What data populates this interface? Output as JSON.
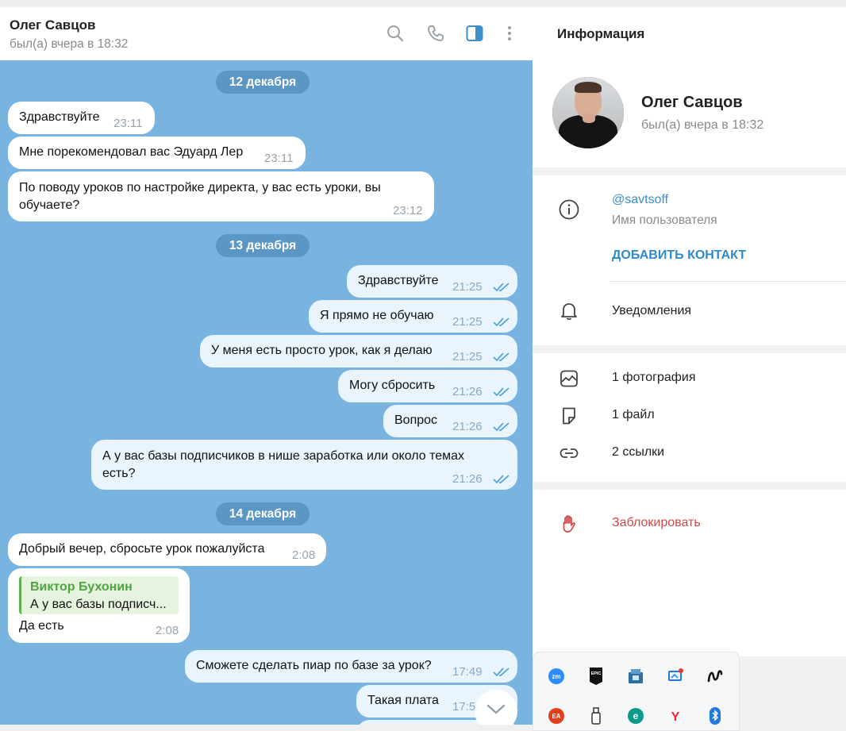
{
  "header": {
    "contact_name": "Олег Савцов",
    "status": "был(а) вчера в 18:32"
  },
  "header_icons": [
    "search-icon",
    "phone-icon",
    "sidebar-toggle-icon",
    "more-vertical-icon"
  ],
  "dates": [
    "12 декабря",
    "13 декабря",
    "14 декабря"
  ],
  "messages": [
    {
      "dir": "in",
      "text": "Здравствуйте",
      "time": "23:11"
    },
    {
      "dir": "in",
      "text": "Мне порекомендовал вас Эдуард Лер",
      "time": "23:11"
    },
    {
      "dir": "in",
      "line1": "По поводу уроков по настройке директа, у вас есть уроки, вы",
      "line2": "обучаете?",
      "time": "23:12"
    },
    {
      "dir": "out",
      "text": "Здравствуйте",
      "time": "21:25"
    },
    {
      "dir": "out",
      "text": "Я прямо не обучаю",
      "time": "21:25"
    },
    {
      "dir": "out",
      "text": "У меня есть просто урок, как я делаю",
      "time": "21:25"
    },
    {
      "dir": "out",
      "text": "Могу сбросить",
      "time": "21:26"
    },
    {
      "dir": "out",
      "text": "Вопрос",
      "time": "21:26"
    },
    {
      "dir": "out",
      "line1": "А у вас базы подписчиков в нише заработка или около темах",
      "line2": "есть?",
      "time": "21:26"
    },
    {
      "dir": "in",
      "text": "Добрый вечер, сбросьте урок пожалуйста",
      "time": "2:08"
    },
    {
      "dir": "in",
      "reply_name": "Виктор Бухонин",
      "reply_text": "А у вас базы подписч...",
      "text": "Да есть",
      "time": "2:08"
    },
    {
      "dir": "out",
      "text": "Сможете сделать пиар по базе за урок?",
      "time": "17:49"
    },
    {
      "dir": "out",
      "text": "Такая плата",
      "time": "17:5"
    }
  ],
  "info": {
    "title": "Информация",
    "name": "Олег Савцов",
    "status": "был(а) вчера в 18:32",
    "username": "@savtsoff",
    "username_label": "Имя пользователя",
    "add_contact": "ДОБАВИТЬ КОНТАКТ",
    "notifications": "Уведомления",
    "photos": "1 фотография",
    "files": "1 файл",
    "links": "2 ссылки",
    "block": "Заблокировать"
  },
  "tray": {
    "icons": [
      "zoom-icon",
      "epic-games-icon",
      "network-drive-icon",
      "remote-desktop-icon",
      "notion-icon",
      "ea-icon",
      "usb-drive-icon",
      "eset-icon",
      "yandex-browser-icon",
      "bluetooth-icon"
    ],
    "labels": {
      "zoom": "zm",
      "epic": "EPIC",
      "ea": "EA",
      "eset": "e",
      "yandex": "Y"
    }
  },
  "colors": {
    "chat_bg": "#79b4e0",
    "date_pill": "#5a97c5",
    "out_bubble": "#e9f4fd",
    "accent": "#3b8fcb",
    "danger": "#d14848",
    "reply_name": "#4ea441"
  }
}
